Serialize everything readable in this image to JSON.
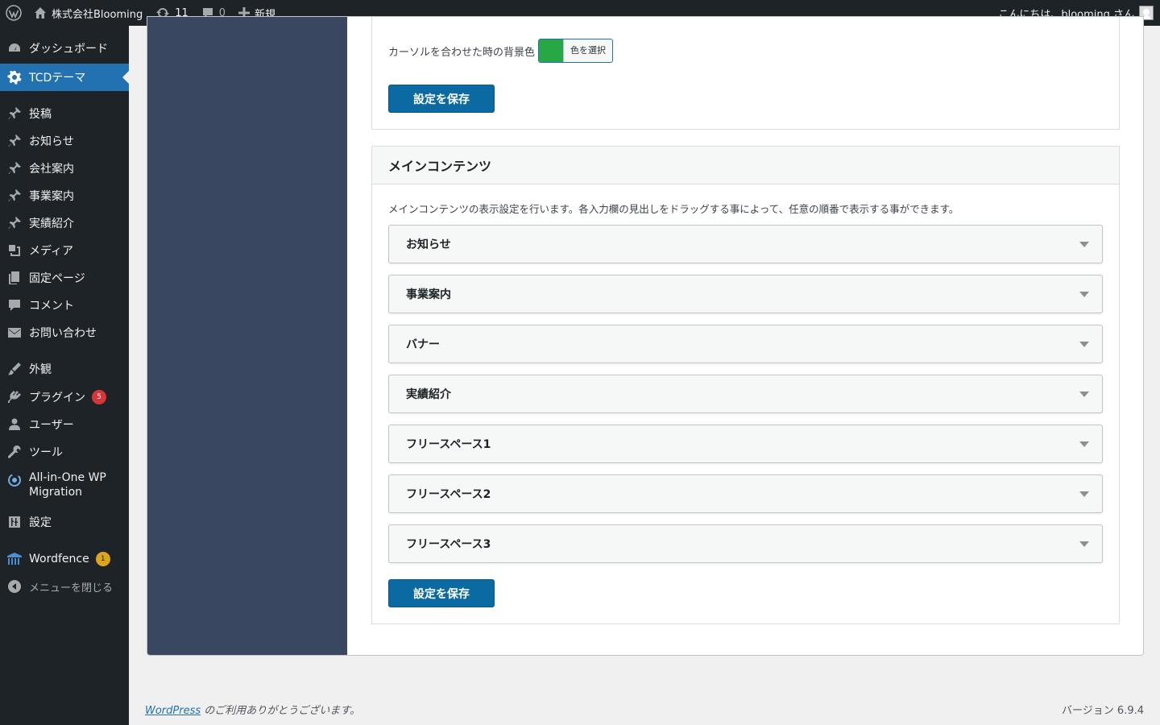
{
  "adminbar": {
    "site_name": "株式会社Blooming",
    "updates_count": "11",
    "comments_count": "0",
    "new_label": "新規",
    "greeting": "こんにちは、blooming さん"
  },
  "sidebar": {
    "items": [
      {
        "label": "ダッシュボード",
        "icon": "dashboard-icon"
      },
      {
        "label": "TCDテーマ",
        "icon": "gear-icon"
      },
      {
        "label": "投稿",
        "icon": "pin-icon"
      },
      {
        "label": "お知らせ",
        "icon": "pin-icon"
      },
      {
        "label": "会社案内",
        "icon": "pin-icon"
      },
      {
        "label": "事業案内",
        "icon": "pin-icon"
      },
      {
        "label": "実績紹介",
        "icon": "pin-icon"
      },
      {
        "label": "メディア",
        "icon": "media-icon"
      },
      {
        "label": "固定ページ",
        "icon": "page-icon"
      },
      {
        "label": "コメント",
        "icon": "comment-icon"
      },
      {
        "label": "お問い合わせ",
        "icon": "mail-icon"
      },
      {
        "label": "外観",
        "icon": "brush-icon"
      },
      {
        "label": "プラグイン",
        "icon": "plugin-icon",
        "badge": "5"
      },
      {
        "label": "ユーザー",
        "icon": "user-icon"
      },
      {
        "label": "ツール",
        "icon": "wrench-icon"
      },
      {
        "label": "All-in-One WP Migration",
        "icon": "migration-icon"
      },
      {
        "label": "設定",
        "icon": "settings-icon"
      },
      {
        "label": "Wordfence",
        "icon": "wordfence-icon",
        "badge": "1"
      },
      {
        "label": "メニューを閉じる",
        "icon": "collapse-icon"
      }
    ]
  },
  "settings": {
    "hover_bg_label": "カーソルを合わせた時の背景色",
    "color_button_label": "色を選択",
    "hover_bg_color": "#28a745",
    "save_label": "設定を保存"
  },
  "main_contents": {
    "title": "メインコンテンツ",
    "description": "メインコンテンツの表示設定を行います。各入力欄の見出しをドラッグする事によって、任意の順番で表示する事ができます。",
    "sections": [
      "お知らせ",
      "事業案内",
      "バナー",
      "実績紹介",
      "フリースペース1",
      "フリースペース2",
      "フリースペース3"
    ],
    "save_label": "設定を保存"
  },
  "footer": {
    "link_text": "WordPress",
    "thanks_text": " のご利用ありがとうございます。",
    "version": "バージョン 6.9.4"
  },
  "colors": {
    "admin_dark": "#1d2327",
    "accent": "#2271b1",
    "panel_nav": "#3a4760"
  }
}
